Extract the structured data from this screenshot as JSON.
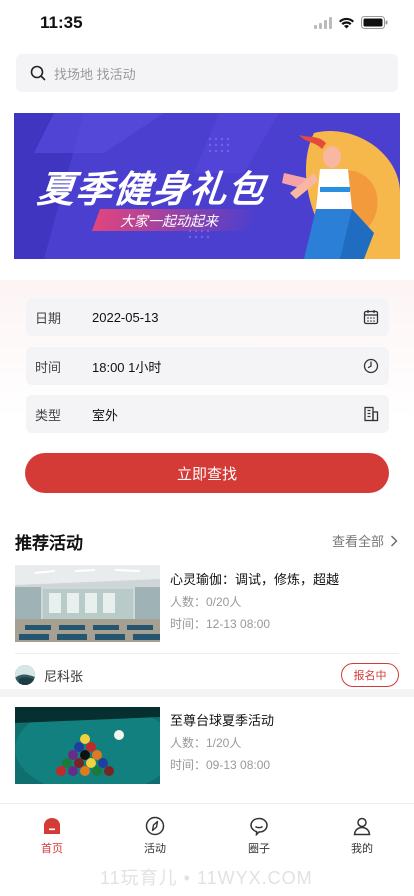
{
  "status_bar": {
    "time": "11:35"
  },
  "search": {
    "placeholder": "找场地 找活动"
  },
  "banner": {
    "title": "夏季健身礼包",
    "subtitle": "大家一起动起来"
  },
  "form": {
    "date": {
      "label": "日期",
      "value": "2022-05-13",
      "icon": "calendar-icon"
    },
    "time": {
      "label": "时间",
      "value": "18:00 1小时",
      "icon": "clock-icon"
    },
    "type": {
      "label": "类型",
      "value": "室外",
      "icon": "building-icon"
    },
    "submit_label": "立即查找"
  },
  "recommended": {
    "title": "推荐活动",
    "view_all": "查看全部",
    "items": [
      {
        "title": "心灵瑜伽：调试，修炼，超越",
        "people": "人数：0/20人",
        "time": "时间：12-13 08:00",
        "host": "尼科张",
        "status": "报名中"
      },
      {
        "title": "至尊台球夏季活动",
        "people": "人数：1/20人",
        "time": "时间：09-13 08:00"
      }
    ]
  },
  "tabbar": {
    "items": [
      {
        "label": "首页",
        "icon": "home-icon",
        "active": true
      },
      {
        "label": "活动",
        "icon": "compass-icon",
        "active": false
      },
      {
        "label": "圈子",
        "icon": "chat-icon",
        "active": false
      },
      {
        "label": "我的",
        "icon": "user-icon",
        "active": false
      }
    ]
  },
  "watermark": "11玩育儿 • 11WYX.COM",
  "colors": {
    "accent": "#d43b37",
    "banner_bg": "#4b3fcf"
  }
}
